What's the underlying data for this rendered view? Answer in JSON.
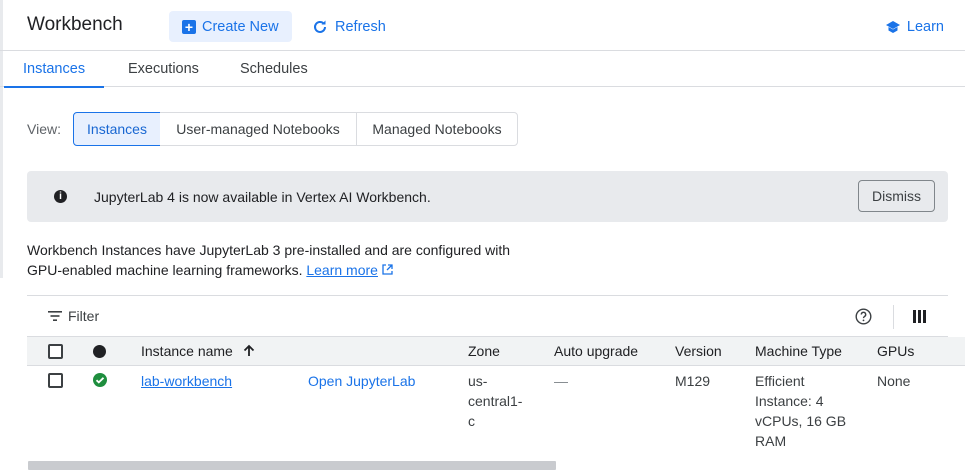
{
  "header": {
    "title": "Workbench",
    "create_label": "Create New",
    "refresh_label": "Refresh",
    "learn_label": "Learn"
  },
  "tabs": [
    {
      "label": "Instances",
      "active": true
    },
    {
      "label": "Executions",
      "active": false
    },
    {
      "label": "Schedules",
      "active": false
    }
  ],
  "view": {
    "label": "View:",
    "options": [
      "Instances",
      "User-managed Notebooks",
      "Managed Notebooks"
    ],
    "selected": "Instances"
  },
  "banner": {
    "message": "JupyterLab 4 is now available in Vertex AI Workbench.",
    "dismiss_label": "Dismiss"
  },
  "description": {
    "line1": "Workbench Instances have JupyterLab 3 pre-installed and are configured with",
    "line2": "GPU-enabled machine learning frameworks.",
    "learn_more": "Learn more"
  },
  "filter": {
    "label": "Filter"
  },
  "table": {
    "columns": [
      "Instance name",
      "Zone",
      "Auto upgrade",
      "Version",
      "Machine Type",
      "GPUs"
    ],
    "rows": [
      {
        "name": "lab-workbench",
        "action": "Open JupyterLab",
        "zone_l1": "us-",
        "zone_l2": "central1-",
        "zone_l3": "c",
        "auto_upgrade": "—",
        "version": "M129",
        "machine_l1": "Efficient",
        "machine_l2": "Instance: 4",
        "machine_l3": "vCPUs, 16 GB",
        "machine_l4": "RAM",
        "gpus": "None",
        "status": "running"
      }
    ]
  },
  "colors": {
    "accent": "#1a73e8",
    "status_ok": "#1e8e3e",
    "banner_bg": "#e8eaed"
  }
}
